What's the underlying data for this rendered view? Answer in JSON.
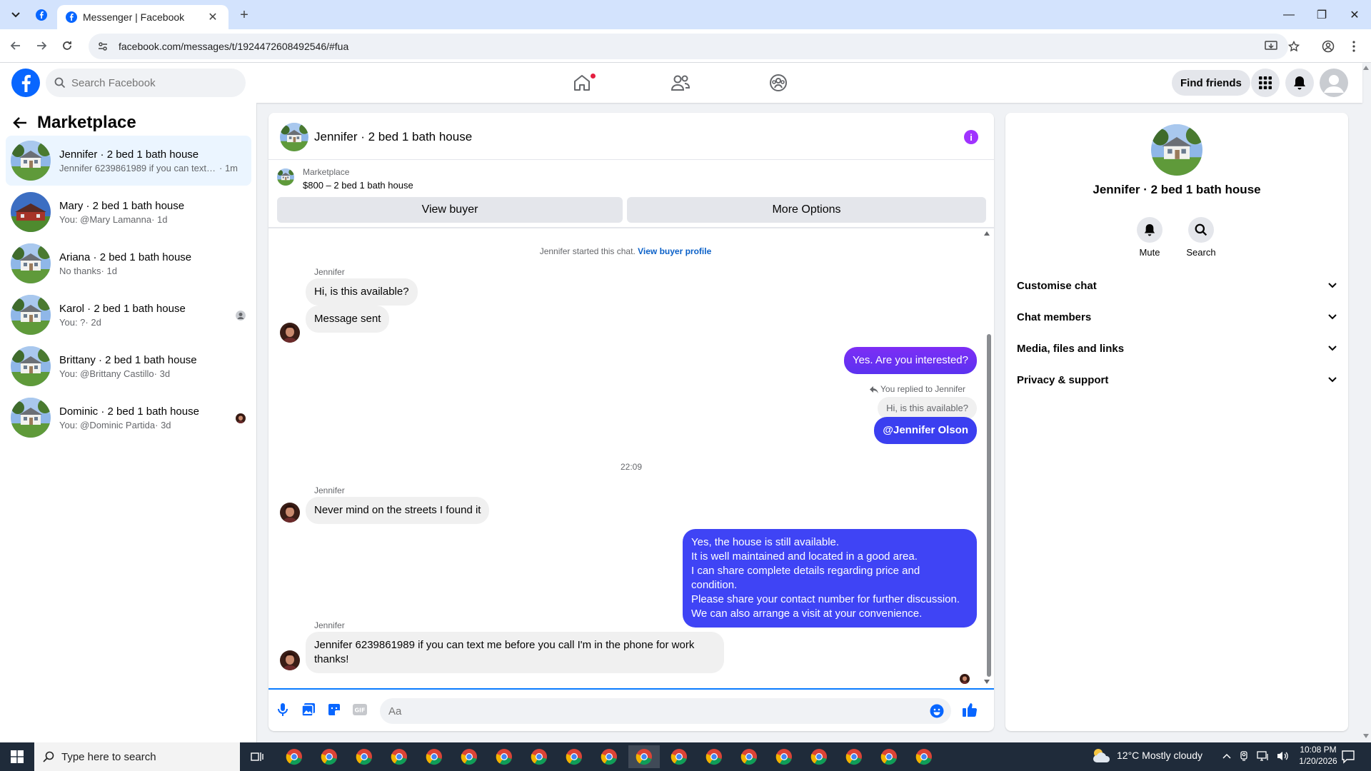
{
  "browser": {
    "tab_title": "Messenger | Facebook",
    "url": "facebook.com/messages/t/1924472608492546/#fua"
  },
  "fb": {
    "search_placeholder": "Search Facebook",
    "find_friends": "Find friends"
  },
  "sidebar": {
    "title": "Marketplace",
    "conversations": [
      {
        "name": "Jennifer · 2 bed 1 bath house",
        "preview": "Jennifer 6239861989 if you can text ...",
        "time": "· 1m"
      },
      {
        "name": "Mary · 2 bed 1 bath house",
        "preview": "You: @Mary Lamanna",
        "time": " · 1d"
      },
      {
        "name": "Ariana · 2 bed 1 bath house",
        "preview": "No thanks",
        "time": " · 1d"
      },
      {
        "name": "Karol · 2 bed 1 bath house",
        "preview": "You: ?",
        "time": " · 2d"
      },
      {
        "name": "Brittany · 2 bed 1 bath house",
        "preview": "You: @Brittany Castillo",
        "time": " · 3d"
      },
      {
        "name": "Dominic · 2 bed 1 bath house",
        "preview": "You: @Dominic Partida",
        "time": " · 3d"
      }
    ]
  },
  "chat": {
    "title": "Jennifer · 2 bed 1 bath house",
    "marketplace_label": "Marketplace",
    "listing": "$800 – 2 bed 1 bath house",
    "view_buyer": "View buyer",
    "more_options": "More Options",
    "started_text": "Jennifer started this chat.",
    "view_buyer_profile": "View buyer profile",
    "sender": "Jennifer",
    "msg1": "Hi, is this available?",
    "msg2": "Message sent",
    "msg3": "Yes. Are you interested?",
    "replied_label": "You replied to Jennifer",
    "quoted": "Hi, is this available?",
    "msg4": "@Jennifer Olson",
    "timestamp": "22:09",
    "msg5": "Never mind on the streets I found it",
    "msg6_lines": [
      "Yes, the house is still available.",
      "It is well maintained and located in a good area.",
      "I can share complete details regarding price and condition.",
      "Please share your contact number for further discussion.",
      "We can also arrange a visit at your convenience."
    ],
    "msg7": "Jennifer 6239861989 if you can text me before you call I'm in the phone for work thanks!",
    "input_placeholder": "Aa"
  },
  "details": {
    "name": "Jennifer · 2 bed 1 bath house",
    "mute": "Mute",
    "search": "Search",
    "sections": [
      "Customise chat",
      "Chat members",
      "Media, files and links",
      "Privacy & support"
    ]
  },
  "taskbar": {
    "search_placeholder": "Type here to search",
    "weather": "12°C  Mostly cloudy",
    "time": "10:08 PM",
    "date": "1/20/2026"
  },
  "colors": {
    "fb_blue": "#0866ff",
    "messenger_purple": "#a033ff",
    "my_bubble": "#3f44f5"
  }
}
